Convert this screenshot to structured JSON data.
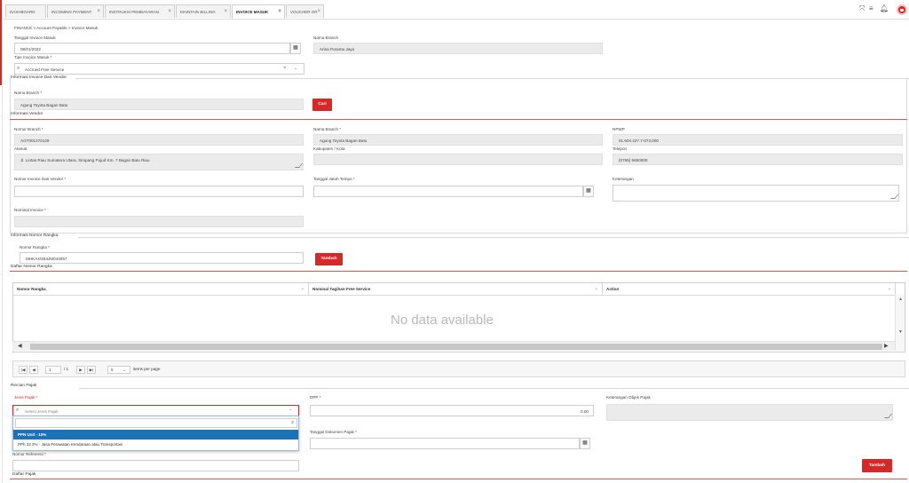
{
  "tabs": [
    {
      "label": "DASHBOARD",
      "closable": false,
      "active": false
    },
    {
      "label": "INCOMING PAYMENT",
      "closable": true,
      "active": false
    },
    {
      "label": "INSTRUKSI PEMBAYARAN",
      "closable": true,
      "active": false
    },
    {
      "label": "MAINTAIN BILLING",
      "closable": true,
      "active": false
    },
    {
      "label": "INVOICE MASUK",
      "closable": true,
      "active": true
    },
    {
      "label": "VOUCHER GR",
      "closable": true,
      "active": false
    }
  ],
  "topbar_icons": [
    "expand-icon",
    "menu-icon",
    "bell-icon",
    "user-avatar-icon"
  ],
  "close_glyph": "×",
  "breadcrumb": "FINANCE > Account Payable > Invoice Masuk",
  "header": {
    "tanggal_label": "Tanggal Invoice Masuk",
    "tanggal_value": "08/01/2022",
    "nama_branch_label": "Nama Branch",
    "nama_branch_value": "Arina Purama Jaya",
    "tipe_label": "Tipe Invoice Masuk *",
    "tipe_value": "Accrued Free Service"
  },
  "vendor_section": {
    "title": "Informasi Invoice Dari Vendor",
    "nama_branch_label": "Nama Branch *",
    "nama_branch_value": "Agung Toyota Bagan Batu",
    "cari_label": "Cari"
  },
  "info_vendor": {
    "title": "Informasi Vendor",
    "nomor_branch_label": "Nomor Branch *",
    "nomor_branch_value": "AGT001270129",
    "nama_branch_label": "Nama Branch *",
    "nama_branch_value": "Agung Toyota Bagan Batu",
    "npwp_label": "NPWP",
    "npwp_value": "01.604.227.7-073.000",
    "alamat_label": "Alamat",
    "alamat_value": "Jl. Lintas  Riau Sumatera Utara, Simpang Pujud  Km. 7 Bagan Batu  Riau",
    "kabupaten_label": "Kabupaten / Kota",
    "kabupaten_value": "",
    "telepon_label": "Telepon",
    "telepon_value": "(0765) 5650000",
    "nomor_invoice_label": "Nomor Invoice Dari Vendor *",
    "nomor_invoice_value": "",
    "jatuh_tempo_label": "Tanggal Jatuh Tempo *",
    "jatuh_tempo_value": "",
    "keterangan_label": "Keterangan",
    "keterangan_value": "",
    "nominal_label": "Nominal Invoice *",
    "nominal_value": ""
  },
  "rangka_section": {
    "title": "Informasi Nomor Rangka",
    "nomor_rangka_label": "Nomor Rangka *",
    "nomor_rangka_value": "MHKA4GB3JM043057",
    "tambah_label": "Tambah",
    "daftar_title": "Daftar Nomor Rangka"
  },
  "grid": {
    "columns": [
      "Nomor Rangka",
      "Nominal Tagihan Free Service",
      "Action"
    ],
    "empty_text": "No data available",
    "pager": {
      "first": "|◀",
      "prev": "◀",
      "page": "1",
      "of": "/ 1",
      "next": "▶",
      "last": "▶|",
      "page_size": "5",
      "items_per_page": "items per page"
    }
  },
  "pajak_section": {
    "title": "Rincian Pajak",
    "jenis_label": "Jenis Pajak *",
    "jenis_placeholder": "Select Jenis Pajak",
    "dpp_label": "DPP *",
    "dpp_value": "0,00",
    "keterangan_label": "Keterangan Objek Pajak",
    "tanggal_dok_label": "Tanggal Dokumen Pajak *",
    "tanggal_dok_value": "",
    "nomor_referensi_label": "Nomor Referensi *",
    "tambah_label": "Tambah",
    "daftar_title": "Daftar Pajak",
    "options": [
      {
        "label": "PPN Unit - 10%",
        "selected": true
      },
      {
        "label": "PPh 23 2% - Jasa Perawatan Kendaraan atau Transportasi",
        "selected": false
      }
    ]
  },
  "colors": {
    "accent_red": "#d62828",
    "selected_blue": "#1a73b8",
    "readonly_gray": "#ebebeb"
  }
}
